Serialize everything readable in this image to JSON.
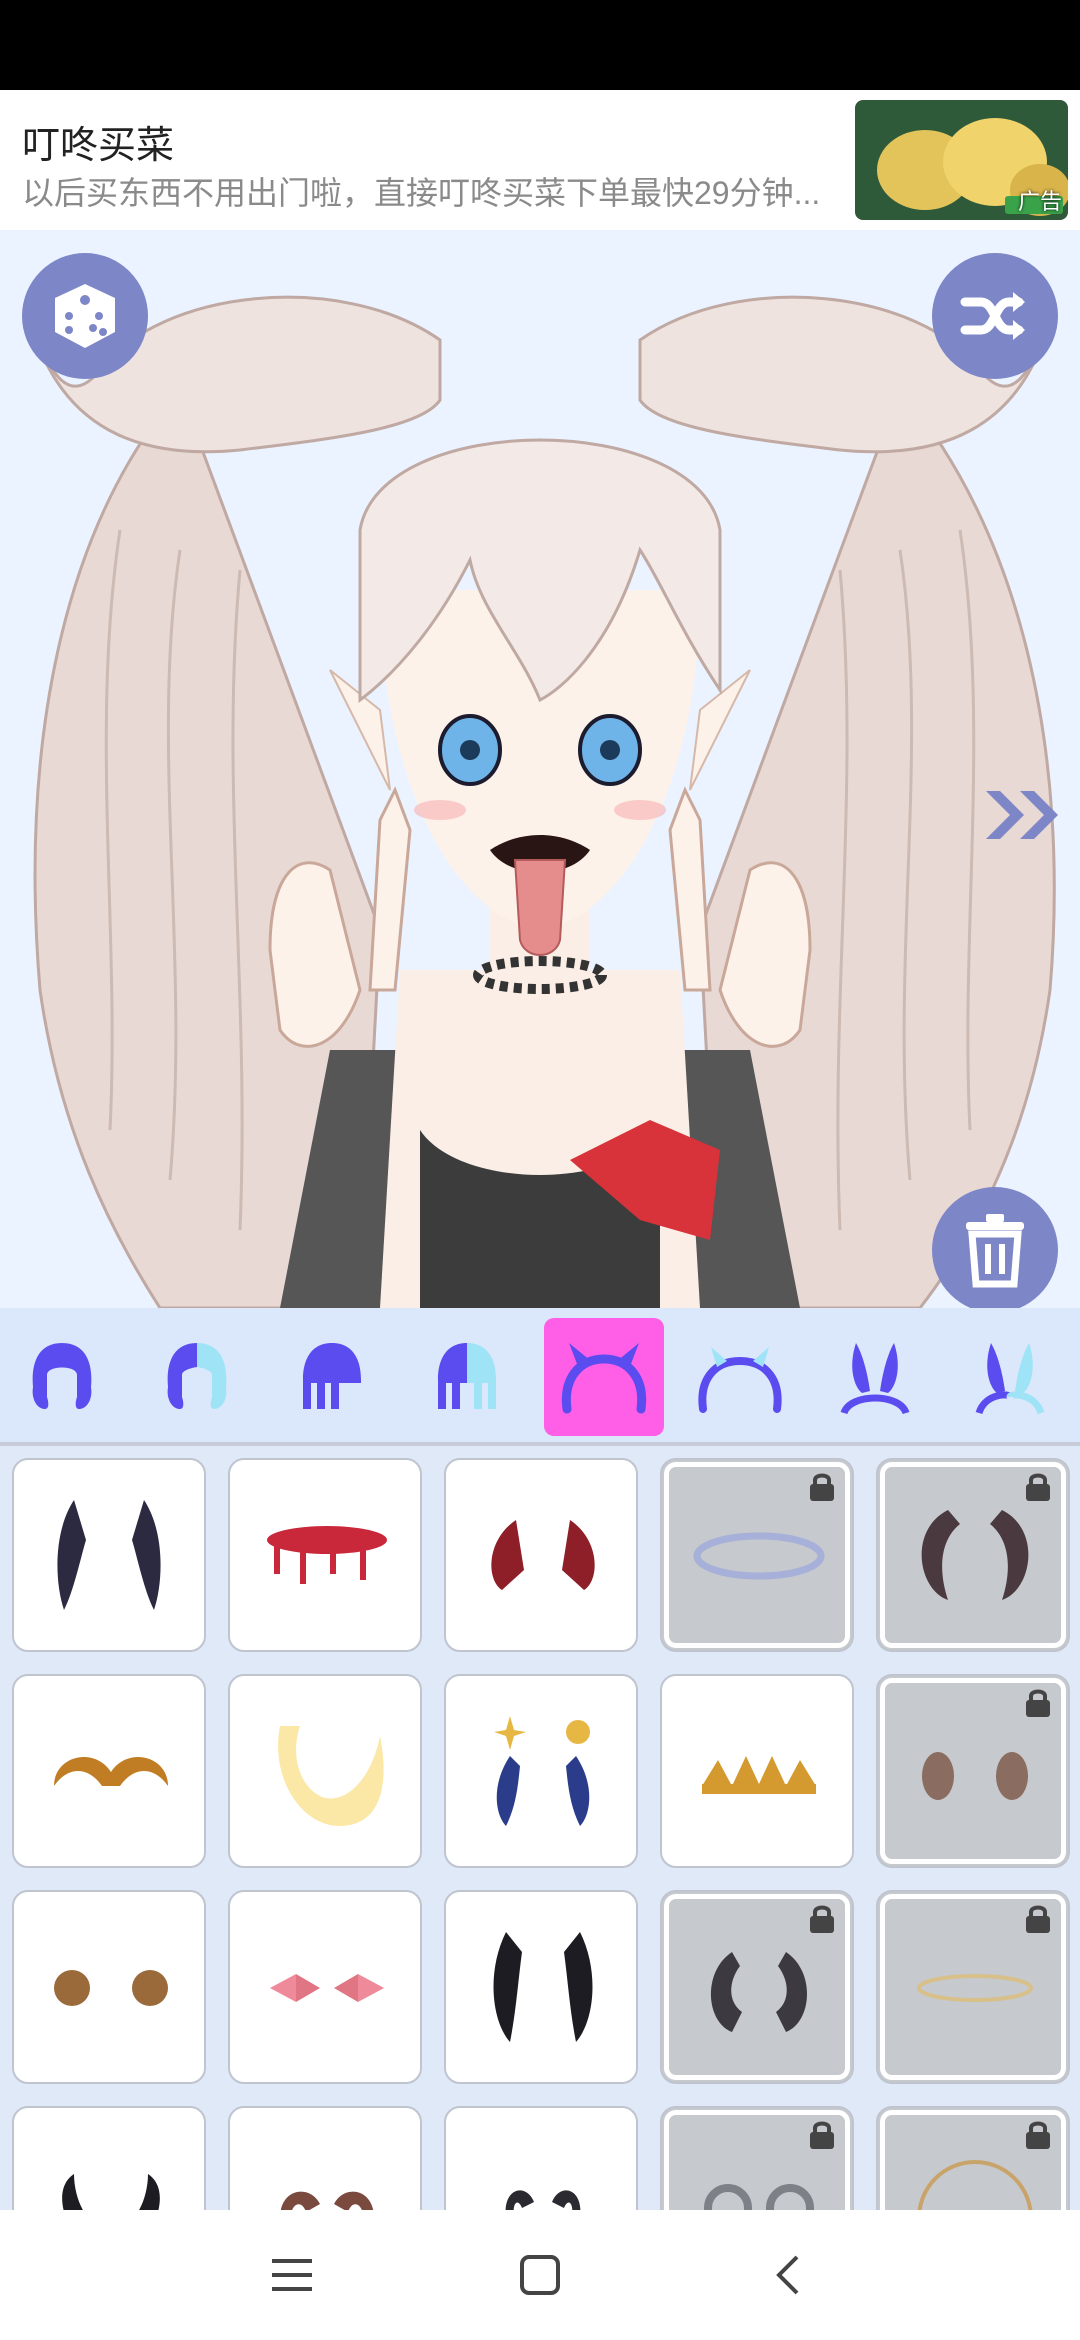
{
  "ad": {
    "title": "叮咚买菜",
    "description": "以后买东西不用出门啦，直接叮咚买菜下单最快29分钟...",
    "tag": "广告"
  },
  "canvas": {
    "dice_icon": "dice-icon",
    "shuffle_icon": "shuffle-icon",
    "next_icon": "double-chevron-right-icon",
    "delete_icon": "trash-icon"
  },
  "categories": [
    {
      "name": "hair-full",
      "active": false
    },
    {
      "name": "hair-dual-color",
      "active": false
    },
    {
      "name": "hair-short",
      "active": false
    },
    {
      "name": "hair-short-dual",
      "active": false
    },
    {
      "name": "horns-headband",
      "active": true
    },
    {
      "name": "headband",
      "active": false
    },
    {
      "name": "bunny-ears",
      "active": false
    },
    {
      "name": "bunny-ears-dual",
      "active": false
    }
  ],
  "items": [
    {
      "icon": "dark-demon-horns-icon",
      "locked": false
    },
    {
      "icon": "blood-drip-halo-icon",
      "locked": false
    },
    {
      "icon": "red-wing-horns-icon",
      "locked": false
    },
    {
      "icon": "silver-halo-icon",
      "locked": true
    },
    {
      "icon": "red-curved-horns-icon",
      "locked": true
    },
    {
      "icon": "golden-mustache-horns-icon",
      "locked": false
    },
    {
      "icon": "crescent-moon-icon",
      "locked": false
    },
    {
      "icon": "star-moon-horns-icon",
      "locked": false
    },
    {
      "icon": "golden-crown-icon",
      "locked": false
    },
    {
      "icon": "ram-horns-icon",
      "locked": true
    },
    {
      "icon": "bronze-ram-horns-icon",
      "locked": false
    },
    {
      "icon": "pink-bows-icon",
      "locked": false
    },
    {
      "icon": "black-red-horns-icon",
      "locked": false
    },
    {
      "icon": "twisted-horns-icon",
      "locked": true
    },
    {
      "icon": "gold-halo-icon",
      "locked": true
    },
    {
      "icon": "small-black-horns-icon",
      "locked": false
    },
    {
      "icon": "brown-curl-horns-icon",
      "locked": false
    },
    {
      "icon": "black-curl-horns-icon",
      "locked": false
    },
    {
      "icon": "grey-ram-horns-icon",
      "locked": true
    },
    {
      "icon": "gold-ring-icon",
      "locked": true
    }
  ],
  "colors": {
    "accent": "#5b4cf0",
    "active_tab": "#ff5ee6",
    "button_bg": "#7d86c7"
  }
}
